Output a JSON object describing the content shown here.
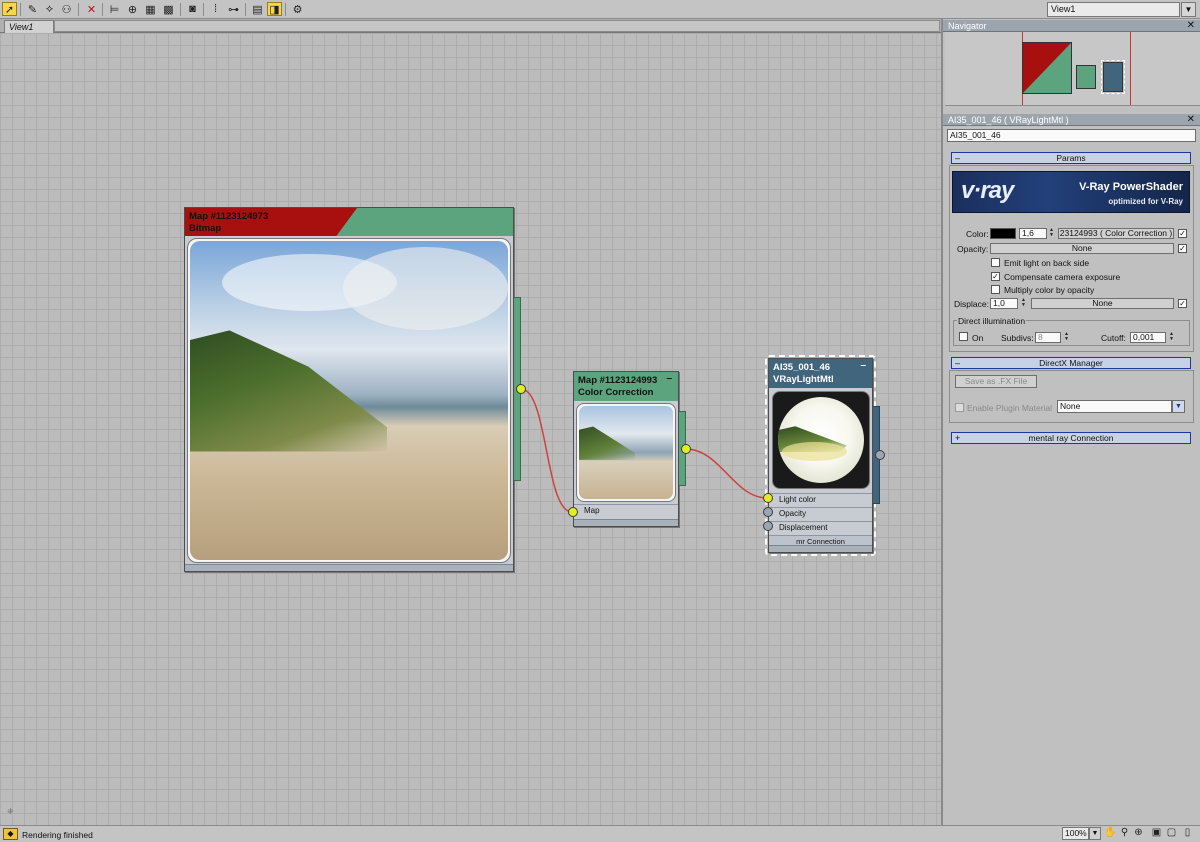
{
  "toolbar": {
    "tools": [
      {
        "name": "select-tool-icon",
        "glyph": "➚",
        "active": true
      },
      {
        "name": "pick-tool-icon",
        "glyph": "✎"
      },
      {
        "name": "lasso-tool-icon",
        "glyph": "⟡"
      },
      {
        "name": "move-children-icon",
        "glyph": "⚇"
      },
      {
        "name": "delete-icon",
        "glyph": "✕"
      },
      {
        "name": "layout-icon",
        "glyph": "⊨"
      },
      {
        "name": "material-to-scene-icon",
        "glyph": "⊕"
      },
      {
        "name": "pattern-icon",
        "glyph": "▦"
      },
      {
        "name": "grid-icon",
        "glyph": "▩"
      },
      {
        "name": "show-map-icon",
        "glyph": "◙"
      },
      {
        "name": "align-icon",
        "glyph": "⁞"
      },
      {
        "name": "hierarchy-icon",
        "glyph": "⊶"
      },
      {
        "name": "parameter-editor-icon",
        "glyph": "▤"
      },
      {
        "name": "highlight-icon",
        "glyph": "◨",
        "active": true
      },
      {
        "name": "render-icon",
        "glyph": "⚙"
      }
    ],
    "view_select": "View1"
  },
  "view_tab": {
    "label": "View1"
  },
  "nodes": {
    "bitmap": {
      "title": "Map #1123124973",
      "subtitle": "Bitmap"
    },
    "color_correction": {
      "title": "Map #1123124993",
      "subtitle": "Color Correction",
      "slot": "Map"
    },
    "vray_mtl": {
      "title": "AI35_001_46",
      "subtitle": "VRayLightMtl",
      "slots": [
        "Light color",
        "Opacity",
        "Displacement"
      ],
      "footer": "mr Connection"
    }
  },
  "navigator": {
    "title": "Navigator"
  },
  "material_panel": {
    "title": "AI35_001_46  ( VRayLightMtl )",
    "name_field": "AI35_001_46",
    "params_rollout": "Params",
    "banner": {
      "logo": "v·ray",
      "heading": "V-Ray PowerShader",
      "sub": "optimized for V-Ray"
    },
    "color_label": "Color:",
    "color_value": "1,6",
    "color_map": "23124993  ( Color Correction )",
    "opacity_label": "Opacity:",
    "opacity_map": "None",
    "checks": [
      {
        "label": "Emit light on back side",
        "checked": false
      },
      {
        "label": "Compensate camera exposure",
        "checked": true
      },
      {
        "label": "Multiply color by opacity",
        "checked": false
      }
    ],
    "displace_label": "Displace:",
    "displace_value": "1,0",
    "displace_map": "None",
    "direct_group": "Direct illumination",
    "on_label": "On",
    "subdivs_label": "Subdivs:",
    "subdivs_value": "8",
    "cutoff_label": "Cutoff:",
    "cutoff_value": "0,001",
    "directx_rollout": "DirectX Manager",
    "save_fx_button": "Save as .FX File",
    "enable_plugin_label": "Enable Plugin Material",
    "plugin_select": "None",
    "mr_rollout": "mental ray Connection"
  },
  "status": {
    "text": "Rendering finished",
    "zoom": "100%"
  },
  "colors": {
    "header_red": "#a80f0f",
    "header_green": "#5ca47e",
    "header_blue": "#42657e",
    "accent_yellow": "#dfee25",
    "wire_red": "#d04040"
  }
}
